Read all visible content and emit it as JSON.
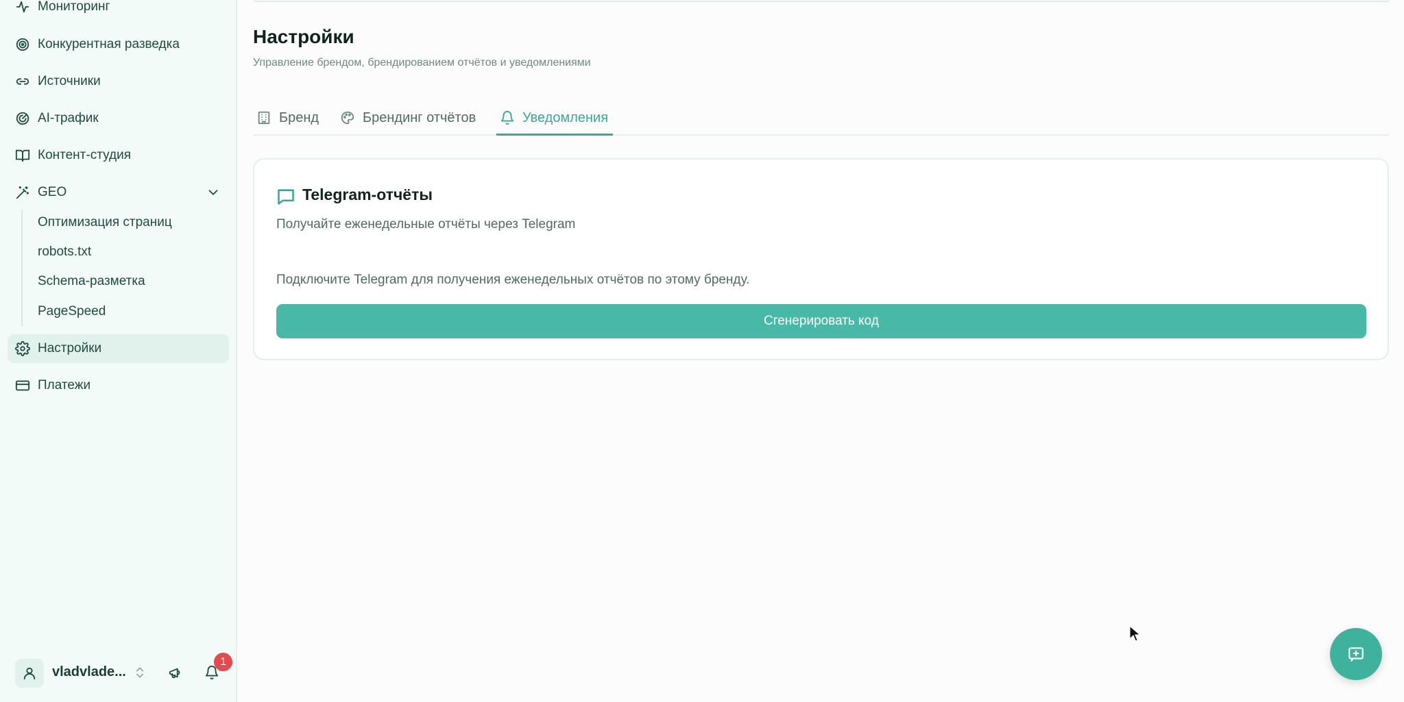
{
  "sidebar": {
    "items": [
      {
        "label": "Мониторинг",
        "icon": "activity-icon"
      },
      {
        "label": "Конкурентная разведка",
        "icon": "target-icon"
      },
      {
        "label": "Источники",
        "icon": "link-icon"
      },
      {
        "label": "AI-трафик",
        "icon": "radar-icon"
      },
      {
        "label": "Контент-студия",
        "icon": "book-open-icon"
      },
      {
        "label": "GEO",
        "icon": "magic-wand-icon"
      },
      {
        "label": "Настройки",
        "icon": "gear-icon"
      },
      {
        "label": "Платежи",
        "icon": "credit-card-icon"
      }
    ],
    "geo_subitems": [
      "Оптимизация страниц",
      "robots.txt",
      "Schema-разметка",
      "PageSpeed"
    ],
    "active_item": "Настройки",
    "user": {
      "name": "vladvlade..."
    },
    "notifications_count": "1"
  },
  "page": {
    "title": "Настройки",
    "subtitle": "Управление брендом, брендированием отчётов и уведомлениями"
  },
  "tabs": [
    {
      "label": "Бренд",
      "icon": "building-icon"
    },
    {
      "label": "Брендинг отчётов",
      "icon": "palette-icon"
    },
    {
      "label": "Уведомления",
      "icon": "bell-icon"
    }
  ],
  "active_tab": "Уведомления",
  "card": {
    "title": "Telegram-отчёты",
    "description": "Получайте еженедельные отчёты через Telegram",
    "text": "Подключите Telegram для получения еженедельных отчётов по этому бренду.",
    "button_label": "Сгенерировать код"
  },
  "colors": {
    "accent": "#3aa895",
    "button": "#48b9a6",
    "sidebar_bg": "#f3fbf8",
    "badge": "#e5484d"
  }
}
